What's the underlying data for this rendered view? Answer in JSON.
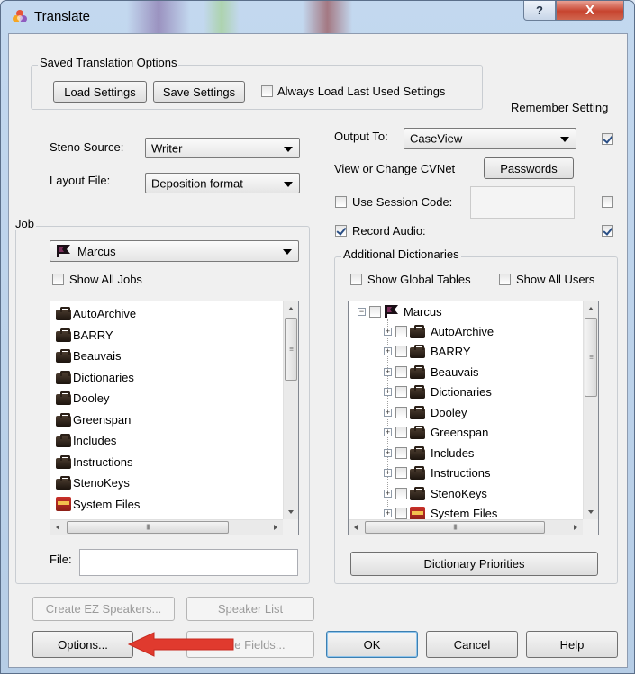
{
  "window": {
    "title": "Translate"
  },
  "saved": {
    "group_label": "Saved Translation Options",
    "load_label": "Load Settings",
    "save_label": "Save Settings",
    "always_label": "Always Load Last Used Settings",
    "always_checked": false
  },
  "remember_label": "Remember Setting",
  "steno": {
    "label": "Steno Source:",
    "value": "Writer"
  },
  "layout": {
    "label": "Layout File:",
    "value": "Deposition format"
  },
  "output": {
    "label": "Output To:",
    "value": "CaseView",
    "remember_checked": true
  },
  "cvnet": {
    "label": "View or Change CVNet",
    "passwords_label": "Passwords"
  },
  "session": {
    "label": "Use Session Code:",
    "checked": false,
    "value": "",
    "remember_checked": false
  },
  "record": {
    "label": "Record Audio:",
    "checked": true,
    "remember_checked": true
  },
  "job": {
    "group_label": "Job",
    "selected": "Marcus",
    "show_all_label": "Show All Jobs",
    "show_all_checked": false,
    "items": [
      "AutoArchive",
      "BARRY",
      "Beauvais",
      "Dictionaries",
      "Dooley",
      "Greenspan",
      "Includes",
      "Instructions",
      "StenoKeys",
      "System Files"
    ],
    "file_label": "File:",
    "file_value": "",
    "hscroll_glyph": "III"
  },
  "dictionaries": {
    "group_label": "Additional Dictionaries",
    "show_global_label": "Show Global Tables",
    "show_all_users_label": "Show All Users",
    "root": "Marcus",
    "items": [
      "AutoArchive",
      "BARRY",
      "Beauvais",
      "Dictionaries",
      "Dooley",
      "Greenspan",
      "Includes",
      "Instructions",
      "StenoKeys",
      "System Files"
    ],
    "priorities_label": "Dictionary Priorities",
    "hscroll_glyph": "III"
  },
  "buttons": {
    "create_ez": "Create EZ Speakers...",
    "speaker_list": "Speaker List",
    "options": "Options...",
    "define_fields": "efine Fields...",
    "ok": "OK",
    "cancel": "Cancel",
    "help": "Help"
  },
  "titlebar_buttons": {
    "help": "?",
    "close": "X"
  },
  "colors": {
    "arrow": "#e03a2e",
    "accent": "#3c7fb1"
  }
}
